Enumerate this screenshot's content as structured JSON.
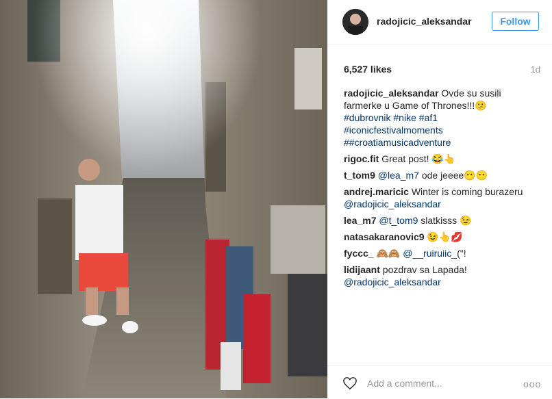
{
  "header": {
    "username": "radojicic_aleksandar",
    "follow_label": "Follow"
  },
  "post": {
    "likes": "6,527 likes",
    "time": "1d"
  },
  "caption": {
    "user": "radojicic_aleksandar",
    "text": "Ovde su susili farmerke u Game of Thrones!!!😕",
    "tags": [
      "#dubrovnik",
      "#nike",
      "#af1",
      "#iconicfestivalmoments",
      "##croatiamusicadventure"
    ]
  },
  "comments": [
    {
      "user": "rigoc.fit",
      "text": "Great post! 😂👆"
    },
    {
      "user": "t_tom9",
      "mention": "@lea_m7",
      "text": "ode jeeee😶😶"
    },
    {
      "user": "andrej.maricic",
      "text": "Winter is coming burazeru",
      "mention": "@radojicic_aleksandar"
    },
    {
      "user": "lea_m7",
      "mention": "@t_tom9",
      "text": "slatkisss 😉"
    },
    {
      "user": "natasakaranovic9",
      "text": "😉👆💋"
    },
    {
      "user": "fyccc_",
      "text": "🙈🙈",
      "mention": "@__ruiruiic_",
      "after": "(\"!"
    },
    {
      "user": "lidijaant",
      "text": "pozdrav sa Lapada!",
      "mention": "@radojicic_aleksandar"
    }
  ],
  "footer": {
    "add_comment_placeholder": "Add a comment...",
    "more_label": "ooo"
  },
  "icons": {
    "heart": "heart-icon",
    "more": "more-options-icon"
  },
  "colors": {
    "accent": "#3897f0",
    "hashtag": "#003569",
    "muted": "#999999"
  }
}
